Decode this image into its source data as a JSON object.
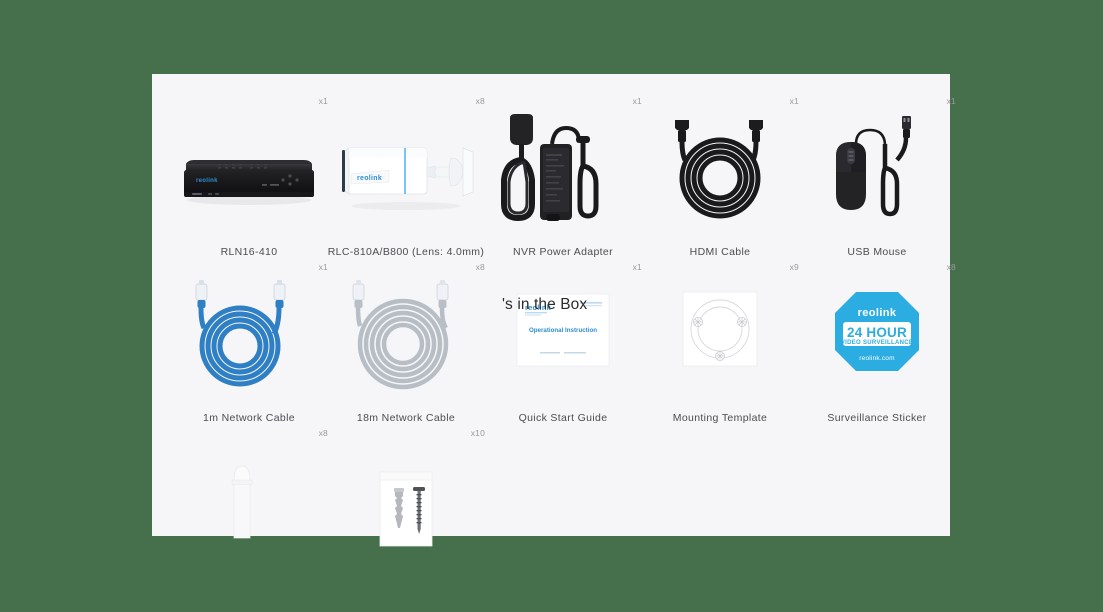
{
  "page": {
    "background_color": "#466f4c",
    "panel_color": "#f6f6f8",
    "overlay_heading": "'s in the Box"
  },
  "items": [
    {
      "name": "RLN16-410",
      "qty": "x1",
      "art": "nvr"
    },
    {
      "name": "RLC-810A/B800 (Lens: 4.0mm)",
      "qty": "x8",
      "art": "camera"
    },
    {
      "name": "NVR Power Adapter",
      "qty": "x1",
      "art": "power-adapter"
    },
    {
      "name": "HDMI Cable",
      "qty": "x1",
      "art": "hdmi-cable"
    },
    {
      "name": "USB Mouse",
      "qty": "x1",
      "art": "usb-mouse"
    },
    {
      "name": "1m Network Cable",
      "qty": "x1",
      "art": "network-cable-blue"
    },
    {
      "name": "18m Network Cable",
      "qty": "x8",
      "art": "network-cable-gray"
    },
    {
      "name": "Quick Start Guide",
      "qty": "x1",
      "art": "quick-start-guide"
    },
    {
      "name": "Mounting Template",
      "qty": "x9",
      "art": "mounting-template"
    },
    {
      "name": "Surveillance Sticker",
      "qty": "x8",
      "art": "surveillance-sticker"
    },
    {
      "name": "",
      "qty": "x8",
      "art": "waterproof-cap"
    },
    {
      "name": "",
      "qty": "x10",
      "art": "screw-pack"
    }
  ],
  "sticker": {
    "brand": "reolink",
    "line1": "24 HOUR",
    "line2": "VIDEO SURVEILLANCE",
    "url": "reolink.com",
    "color": "#2badE2"
  },
  "guide": {
    "brand": "reolink",
    "subtitle": "Operational Instruction"
  },
  "brand": {
    "logo_text": "reolink",
    "logo_color": "#1f9ede"
  }
}
